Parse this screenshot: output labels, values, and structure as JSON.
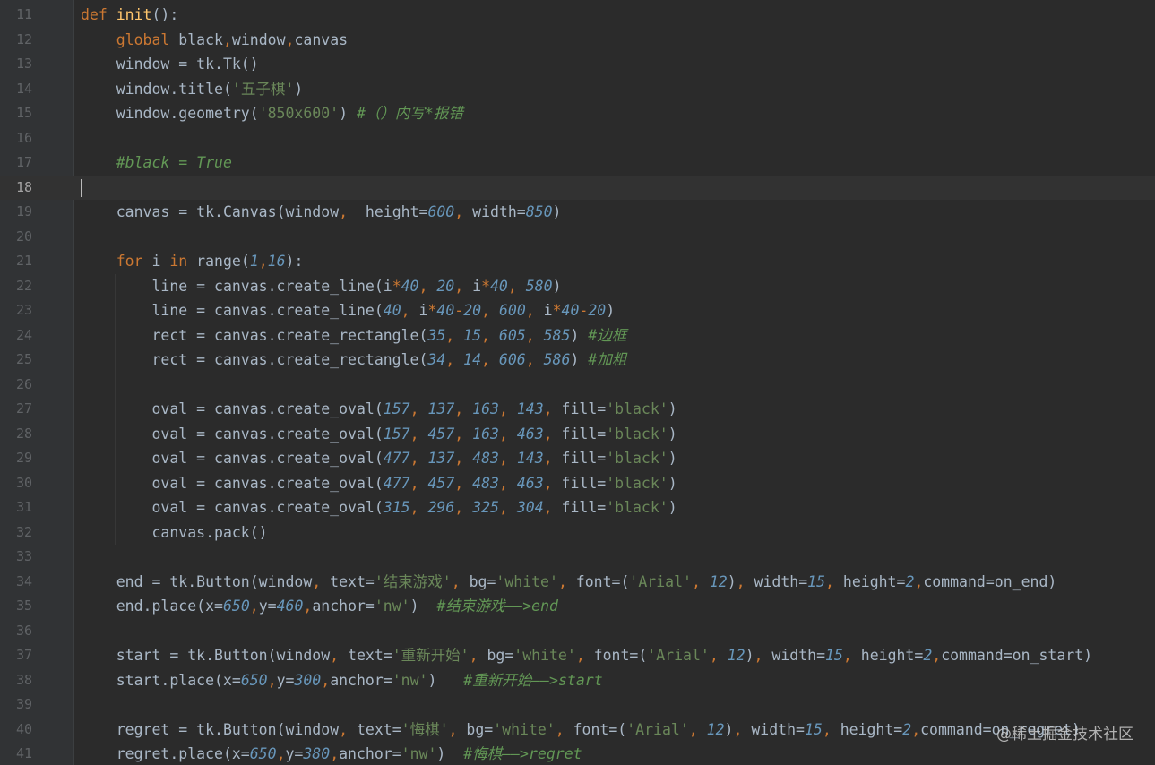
{
  "editor": {
    "current_line": "18",
    "watermark": "@稀土掘金技术社区"
  },
  "lines": [
    {
      "num": "11",
      "code": "def init():"
    },
    {
      "num": "12",
      "code": "    global black,window,canvas"
    },
    {
      "num": "13",
      "code": "    window = tk.Tk()"
    },
    {
      "num": "14",
      "code": "    window.title('五子棋')"
    },
    {
      "num": "15",
      "code": "    window.geometry('850x600') #（）内写*报错"
    },
    {
      "num": "16",
      "code": ""
    },
    {
      "num": "17",
      "code": "    #black = True"
    },
    {
      "num": "18",
      "code": ""
    },
    {
      "num": "19",
      "code": "    canvas = tk.Canvas(window,  height=600, width=850)"
    },
    {
      "num": "20",
      "code": ""
    },
    {
      "num": "21",
      "code": "    for i in range(1,16):"
    },
    {
      "num": "22",
      "code": "        line = canvas.create_line(i*40, 20, i*40, 580)"
    },
    {
      "num": "23",
      "code": "        line = canvas.create_line(40, i*40-20, 600, i*40-20)"
    },
    {
      "num": "24",
      "code": "        rect = canvas.create_rectangle(35, 15, 605, 585) #边框"
    },
    {
      "num": "25",
      "code": "        rect = canvas.create_rectangle(34, 14, 606, 586) #加粗"
    },
    {
      "num": "26",
      "code": ""
    },
    {
      "num": "27",
      "code": "        oval = canvas.create_oval(157, 137, 163, 143, fill='black')"
    },
    {
      "num": "28",
      "code": "        oval = canvas.create_oval(157, 457, 163, 463, fill='black')"
    },
    {
      "num": "29",
      "code": "        oval = canvas.create_oval(477, 137, 483, 143, fill='black')"
    },
    {
      "num": "30",
      "code": "        oval = canvas.create_oval(477, 457, 483, 463, fill='black')"
    },
    {
      "num": "31",
      "code": "        oval = canvas.create_oval(315, 296, 325, 304, fill='black')"
    },
    {
      "num": "32",
      "code": "        canvas.pack()"
    },
    {
      "num": "33",
      "code": ""
    },
    {
      "num": "34",
      "code": "    end = tk.Button(window, text='结束游戏', bg='white', font=('Arial', 12), width=15, height=2,command=on_end)"
    },
    {
      "num": "35",
      "code": "    end.place(x=650,y=460,anchor='nw')  #结束游戏——>end"
    },
    {
      "num": "36",
      "code": ""
    },
    {
      "num": "37",
      "code": "    start = tk.Button(window, text='重新开始', bg='white', font=('Arial', 12), width=15, height=2,command=on_start)"
    },
    {
      "num": "38",
      "code": "    start.place(x=650,y=300,anchor='nw')   #重新开始——>start"
    },
    {
      "num": "39",
      "code": ""
    },
    {
      "num": "40",
      "code": "    regret = tk.Button(window, text='悔棋', bg='white', font=('Arial', 12), width=15, height=2,command=on_regret)"
    },
    {
      "num": "41",
      "code": "    regret.place(x=650,y=380,anchor='nw')  #悔棋——>regret"
    }
  ]
}
